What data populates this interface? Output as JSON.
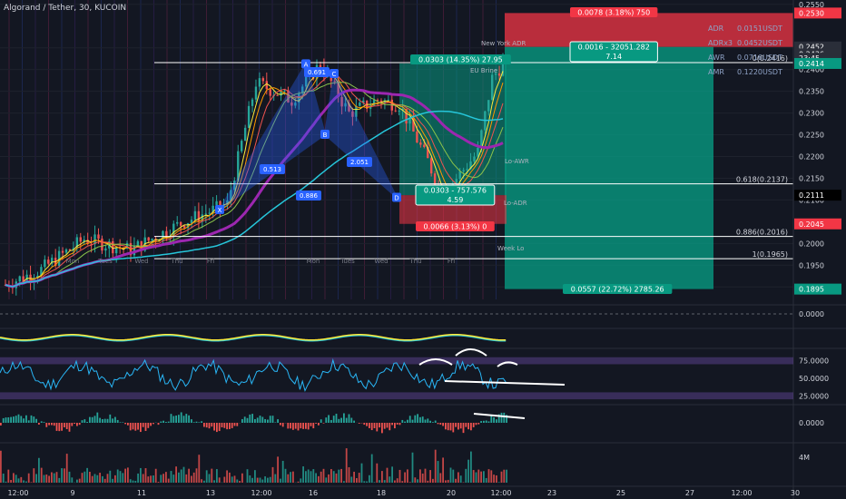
{
  "header": {
    "title": "Algorand / Tether, 30, KUCOIN"
  },
  "colors": {
    "background": "#131722",
    "up": "#26a69a",
    "down": "#ef5350",
    "pattern": "#2962ff",
    "target_zone": "#089981",
    "stop_zone": "#f23645",
    "ma_purple": "#9c27b0",
    "ma_teal": "#26c6da",
    "rsi": "#29b6f6"
  },
  "chart_data": {
    "type": "candlestick",
    "symbol": "Algorand / Tether",
    "timeframe": "30",
    "exchange": "KUCOIN",
    "price_axis": {
      "ylim": [
        0.1865,
        0.256
      ],
      "ticks": [
        "0.2550",
        "0.2450",
        "0.2400",
        "0.2350",
        "0.2300",
        "0.2250",
        "0.2200",
        "0.2150",
        "0.2100",
        "0.2000",
        "0.1950",
        "0.1900"
      ],
      "ticks_val": [
        0.255,
        0.245,
        0.24,
        0.235,
        0.23,
        0.225,
        0.22,
        0.215,
        0.21,
        0.2,
        0.195,
        0.19
      ]
    },
    "price_tags": [
      {
        "text": "0.2530",
        "value": 0.253,
        "color": "#f23645"
      },
      {
        "text": "0.2452",
        "value": 0.2452,
        "color": "#2a2e39"
      },
      {
        "text": "0.2436",
        "value": 0.2436,
        "color": "#2a2e39"
      },
      {
        "text": "23:45",
        "value": 0.2426,
        "color": "#2a2e39"
      },
      {
        "text": "0.2414",
        "value": 0.2414,
        "color": "#089981"
      },
      {
        "text": "0.2111",
        "value": 0.2111,
        "color": "#000000"
      },
      {
        "text": "0.2045",
        "value": 0.2045,
        "color": "#f23645"
      },
      {
        "text": "0.1895",
        "value": 0.1895,
        "color": "#089981"
      }
    ],
    "time_axis": [
      "12:00",
      "9",
      "11",
      "13",
      "12:00",
      "16",
      "18",
      "20",
      "12:00",
      "23",
      "25",
      "27",
      "12:00",
      "30"
    ],
    "day_labels": [
      "Mon",
      "Tues",
      "Wed",
      "Thu",
      "Fri",
      "Mon",
      "Tues",
      "Wed",
      "Thu",
      "Fri"
    ],
    "fib_levels": [
      {
        "label": "0(0.2416)",
        "value": 0.2416
      },
      {
        "label": "0.618(0.2137)",
        "value": 0.2137
      },
      {
        "label": "0.886(0.2016)",
        "value": 0.2016
      },
      {
        "label": "1(0.1965)",
        "value": 0.1965
      }
    ],
    "harmonic_pattern": {
      "points": [
        {
          "label": "X",
          "value": 0.2078
        },
        {
          "label": "A",
          "value": 0.2413
        },
        {
          "label": "B",
          "value": 0.2251
        },
        {
          "label": "C",
          "value": 0.2391
        },
        {
          "label": "D",
          "value": 0.2106
        }
      ],
      "ratios": [
        "0.691",
        "0.513",
        "2.051",
        "0.886"
      ]
    },
    "positions": [
      {
        "label": "0.0303 (14.35%) 27.95",
        "kind": "target"
      },
      {
        "label": "0.0303 - 757.576",
        "sub": "4.59",
        "kind": "entry"
      },
      {
        "label": "0.0066 (3.13%) 0",
        "kind": "stop"
      },
      {
        "label": "0.0078 (3.18%) 750",
        "kind": "stop"
      },
      {
        "label": "0.0016 - 32051.282",
        "sub": "7.14",
        "kind": "entry"
      },
      {
        "label": "0.0557 (22.72%) 2785.26",
        "kind": "target"
      }
    ],
    "range_stats": [
      {
        "name": "ADR",
        "value": "0.0151USDT"
      },
      {
        "name": "ADRx3",
        "value": "0.0452USDT"
      },
      {
        "name": "AWR",
        "value": "0.0716USDT"
      },
      {
        "name": "AMR",
        "value": "0.1220USDT"
      }
    ],
    "level_labels": [
      "Week Lo",
      "Lo-ADR",
      "Lo-AWR",
      "New York ADR",
      "EU Brine"
    ],
    "indicators": [
      {
        "name": "osc1",
        "tick": "0.0000"
      },
      {
        "name": "rsi",
        "ticks": [
          "75.0000",
          "50.0000",
          "25.0000"
        ],
        "ticks_val": [
          75,
          50,
          25
        ]
      },
      {
        "name": "macd_hist",
        "tick": "0.0000"
      },
      {
        "name": "volume",
        "tick": "4M"
      }
    ]
  }
}
